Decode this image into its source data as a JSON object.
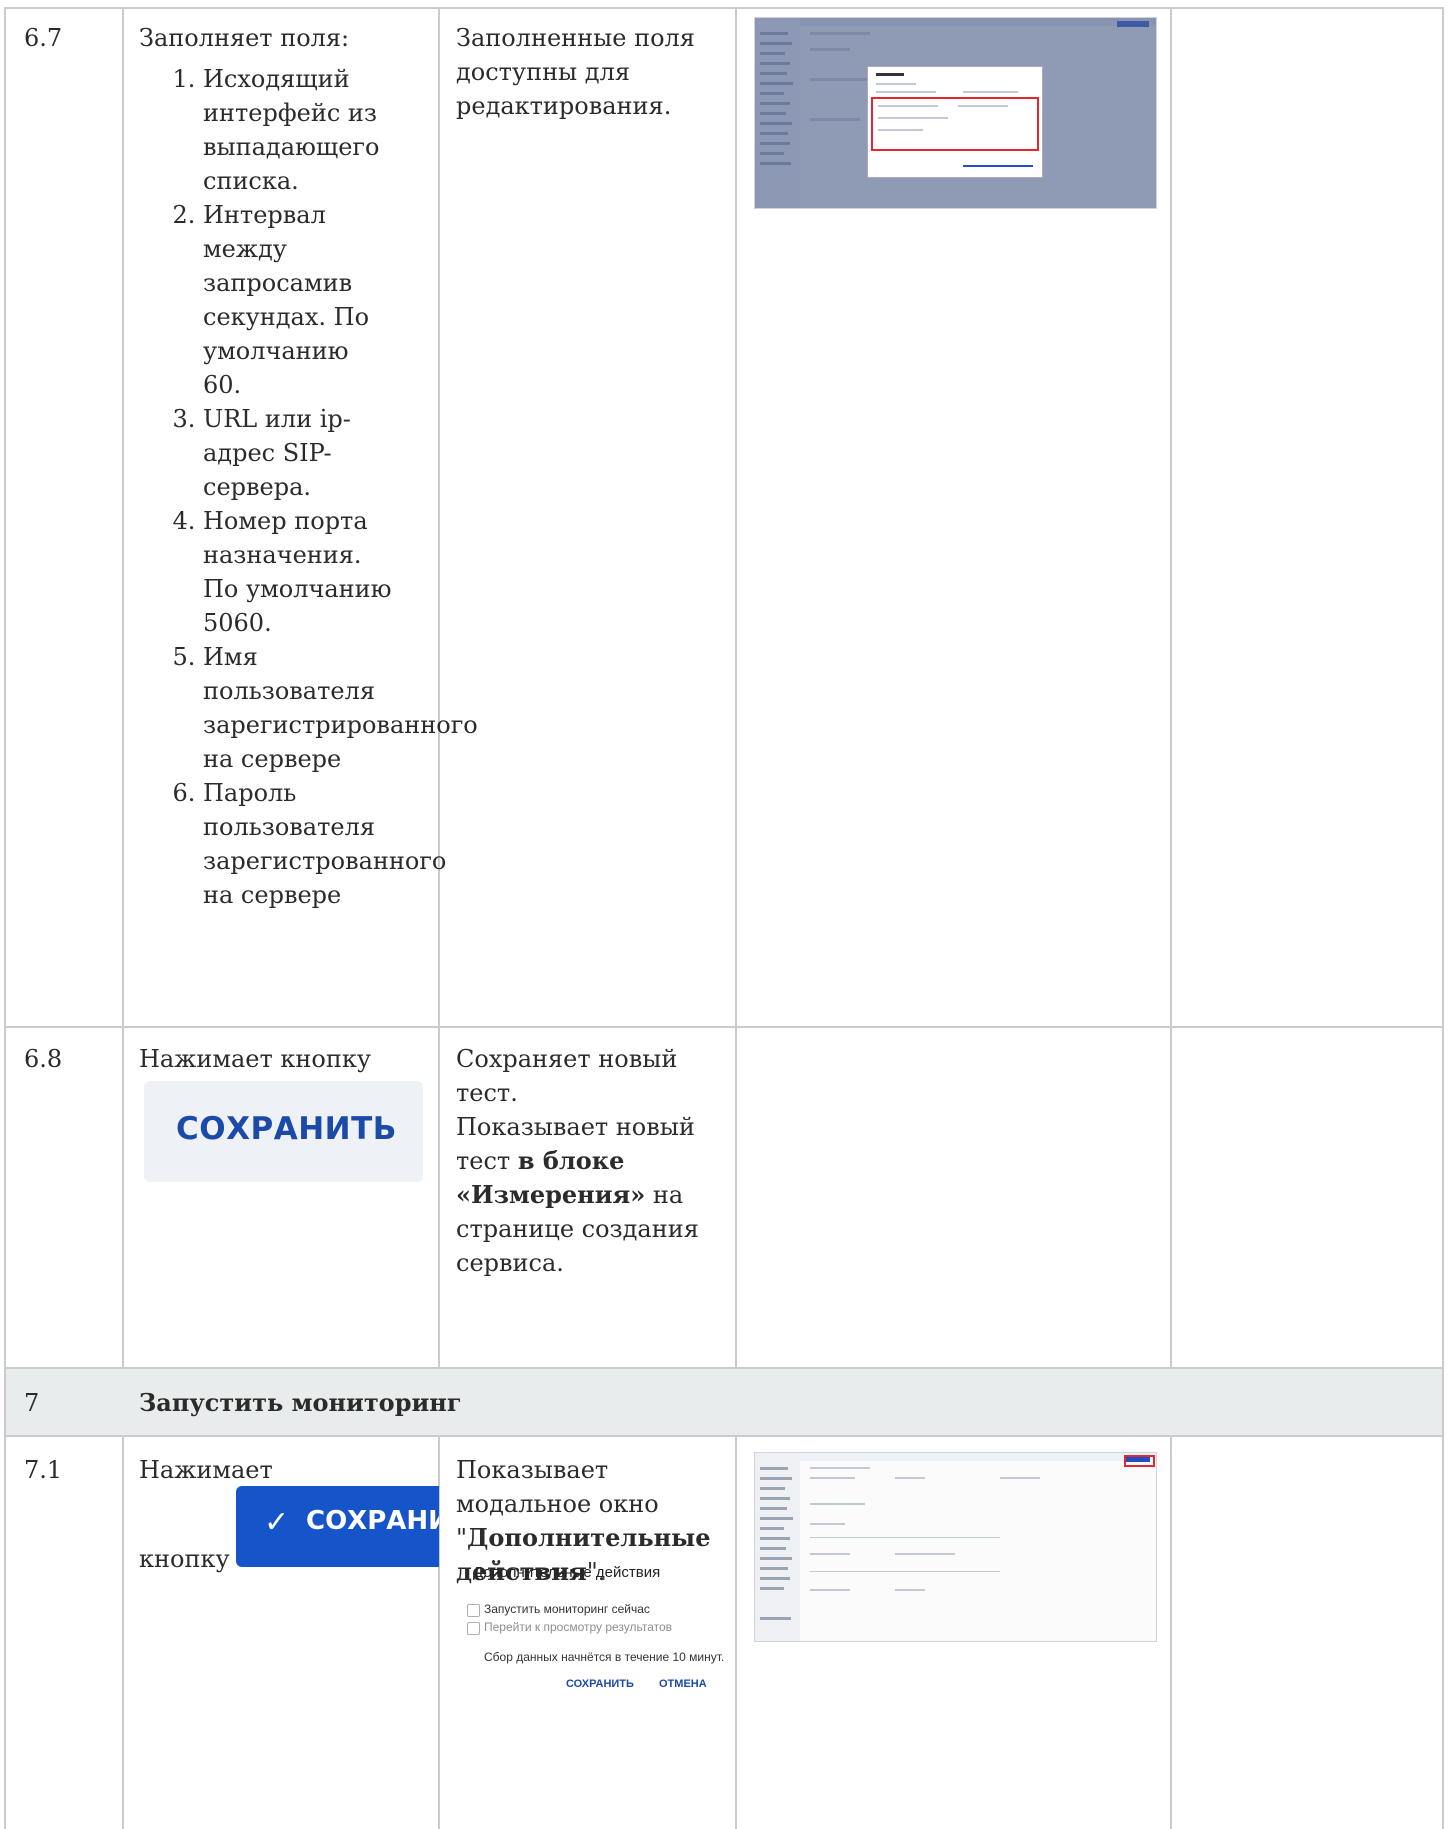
{
  "rows": [
    {
      "num": "6.7",
      "action_intro": "Заполняет поля:",
      "steps": [
        "Исходящий интерфейс из выпадающего списка.",
        "Интервал между запросамив секундах. По умолчанию 60.",
        "URL или ip-адрес SIP-сервера.",
        "Номер порта назначения. По умолчанию 5060.",
        "Имя пользователя зарегистрированного на сервере",
        "Пароль пользователя зарегистрованного на сервере"
      ],
      "result": "Заполненные поля доступны для редактирования."
    },
    {
      "num": "6.8",
      "action": "Нажимает кнопку",
      "button_label": "СОХРАНИТЬ",
      "result_line1": "Сохраняет новый тест.",
      "result_line2_pre": "Показывает новый тест ",
      "result_line2_bold": "в блоке «Измерения»",
      "result_line2_post": " на странице создания сервиса."
    }
  ],
  "section": {
    "num": "7",
    "title": "Запустить мониторинг"
  },
  "row71": {
    "num": "7.1",
    "action_a": "Нажимает",
    "action_b": "кнопку",
    "button_label": "СОХРАНИ",
    "button_icon": "checkmark-icon",
    "result_pre": "Показывает модальное окно \"",
    "result_bold": "Дополнительные действия",
    "result_post": "\".",
    "modal": {
      "title": "Дополнительные действия",
      "option1": "Запустить мониторинг сейчас",
      "option2": "Перейти к просмотру результатов",
      "note": "Сбор данных начнётся в течение 10 минут.",
      "save": "СОХРАНИТЬ",
      "cancel": "ОТМЕНА"
    }
  },
  "colors": {
    "grid": "#c9ccce",
    "section_bg": "#e8ecec",
    "primary_blue": "#1554c9",
    "highlight_red": "#e0282e"
  }
}
